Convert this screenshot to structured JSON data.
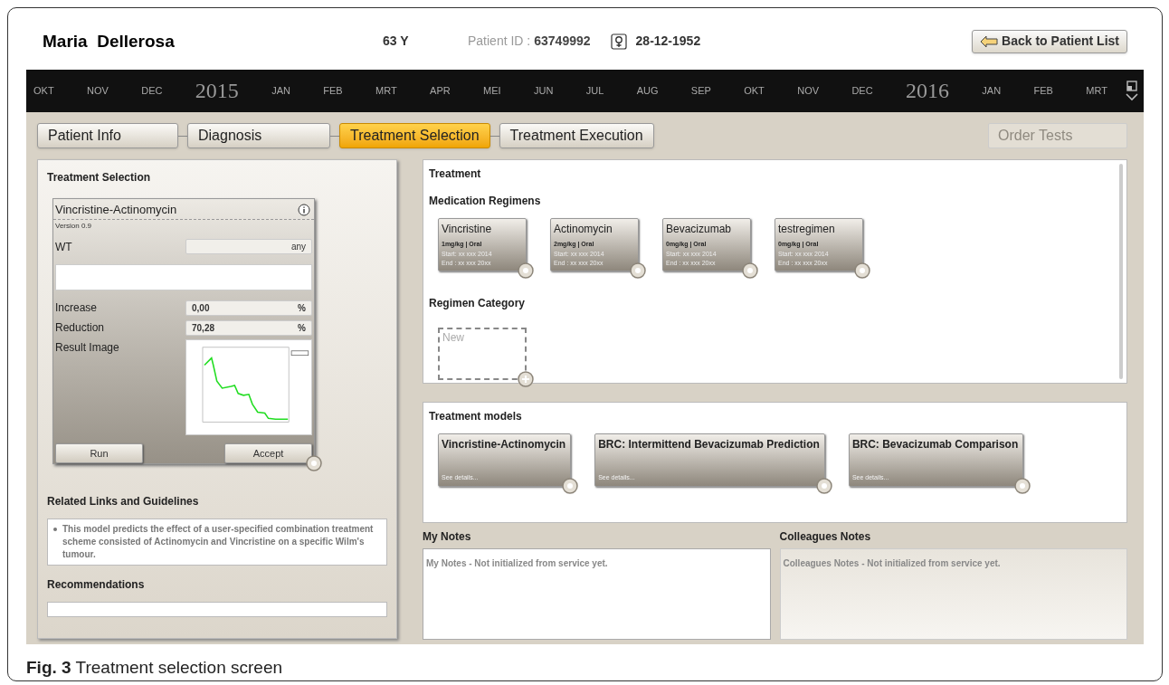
{
  "patient": {
    "name": "Maria  Dellerosa",
    "age": "63 Y",
    "id_label": "Patient ID :",
    "id": "63749992",
    "birth_date": "28-12-1952"
  },
  "back_button": "Back to Patient List",
  "timeline": [
    {
      "label": "OKT",
      "kind": "month"
    },
    {
      "label": "NOV",
      "kind": "month"
    },
    {
      "label": "DEC",
      "kind": "month"
    },
    {
      "label": "2015",
      "kind": "year"
    },
    {
      "label": "JAN",
      "kind": "month"
    },
    {
      "label": "FEB",
      "kind": "month"
    },
    {
      "label": "MRT",
      "kind": "month"
    },
    {
      "label": "APR",
      "kind": "month"
    },
    {
      "label": "MEI",
      "kind": "month"
    },
    {
      "label": "JUN",
      "kind": "month"
    },
    {
      "label": "JUL",
      "kind": "month"
    },
    {
      "label": "AUG",
      "kind": "month"
    },
    {
      "label": "SEP",
      "kind": "month"
    },
    {
      "label": "OKT",
      "kind": "month"
    },
    {
      "label": "NOV",
      "kind": "month"
    },
    {
      "label": "DEC",
      "kind": "month"
    },
    {
      "label": "2016",
      "kind": "year"
    },
    {
      "label": "JAN",
      "kind": "month"
    },
    {
      "label": "FEB",
      "kind": "month"
    },
    {
      "label": "MRT",
      "kind": "month"
    }
  ],
  "tabs": [
    {
      "label": "Patient Info",
      "selected": false
    },
    {
      "label": "Diagnosis",
      "selected": false
    },
    {
      "label": "Treatment Selection",
      "selected": true
    },
    {
      "label": "Treatment Execution",
      "selected": false
    }
  ],
  "order_tests": {
    "label": "Order Tests",
    "disabled": true
  },
  "selection_panel": {
    "title": "Treatment Selection",
    "model": {
      "name": "Vincristine-Actinomycin",
      "version": "Version 0.9",
      "wt_label": "WT",
      "wt_value": "any",
      "fields": [
        {
          "label": "Increase",
          "value": "0,00",
          "unit": "%"
        },
        {
          "label": "Reduction",
          "value": "70,28",
          "unit": "%"
        }
      ],
      "result_label": "Result Image",
      "buttons": [
        "Run",
        "Accept"
      ]
    },
    "links_title": "Related Links and Guidelines",
    "links": [
      "This model predicts the effect of a user-specified combination treatment scheme consisted of Actinomycin and Vincristine on a specific Wilm's tumour."
    ],
    "recommendations_title": "Recommendations"
  },
  "treatment": {
    "title": "Treatment",
    "regimens_title": "Medication Regimens",
    "regimens": [
      {
        "name": "Vincristine",
        "dose": "1mg/kg | Oral",
        "start": "Start: xx xxx 2014",
        "end": "End : xx xxx 20xx"
      },
      {
        "name": "Actinomycin",
        "dose": "2mg/kg | Oral",
        "start": "Start: xx xxx 2014",
        "end": "End : xx xxx 20xx"
      },
      {
        "name": "Bevacizumab",
        "dose": "0mg/kg | Oral",
        "start": "Start: xx xxx 2014",
        "end": "End : xx xxx 20xx"
      },
      {
        "name": "testregimen",
        "dose": "0mg/kg | Oral",
        "start": "Start: xx xxx 2014",
        "end": "End : xx xxx 20xx"
      }
    ],
    "category_title": "Regimen Category",
    "category_new": "New"
  },
  "models": {
    "title": "Treatment models",
    "items": [
      {
        "name": "Vincristine-Actinomycin",
        "link": "See details..."
      },
      {
        "name": "BRC: Intermittend Bevacizumab Prediction",
        "link": "See details..."
      },
      {
        "name": "BRC: Bevacizumab Comparison",
        "link": "See details..."
      }
    ]
  },
  "notes": [
    {
      "title": "My Notes",
      "text": "My Notes - Not initialized from service yet.",
      "kind": "editable"
    },
    {
      "title": "Colleagues Notes",
      "text": "Colleagues Notes - Not initialized from service yet.",
      "kind": "readonly"
    }
  ],
  "caption": {
    "label": "Fig. 3",
    "text": "Treatment selection screen"
  }
}
